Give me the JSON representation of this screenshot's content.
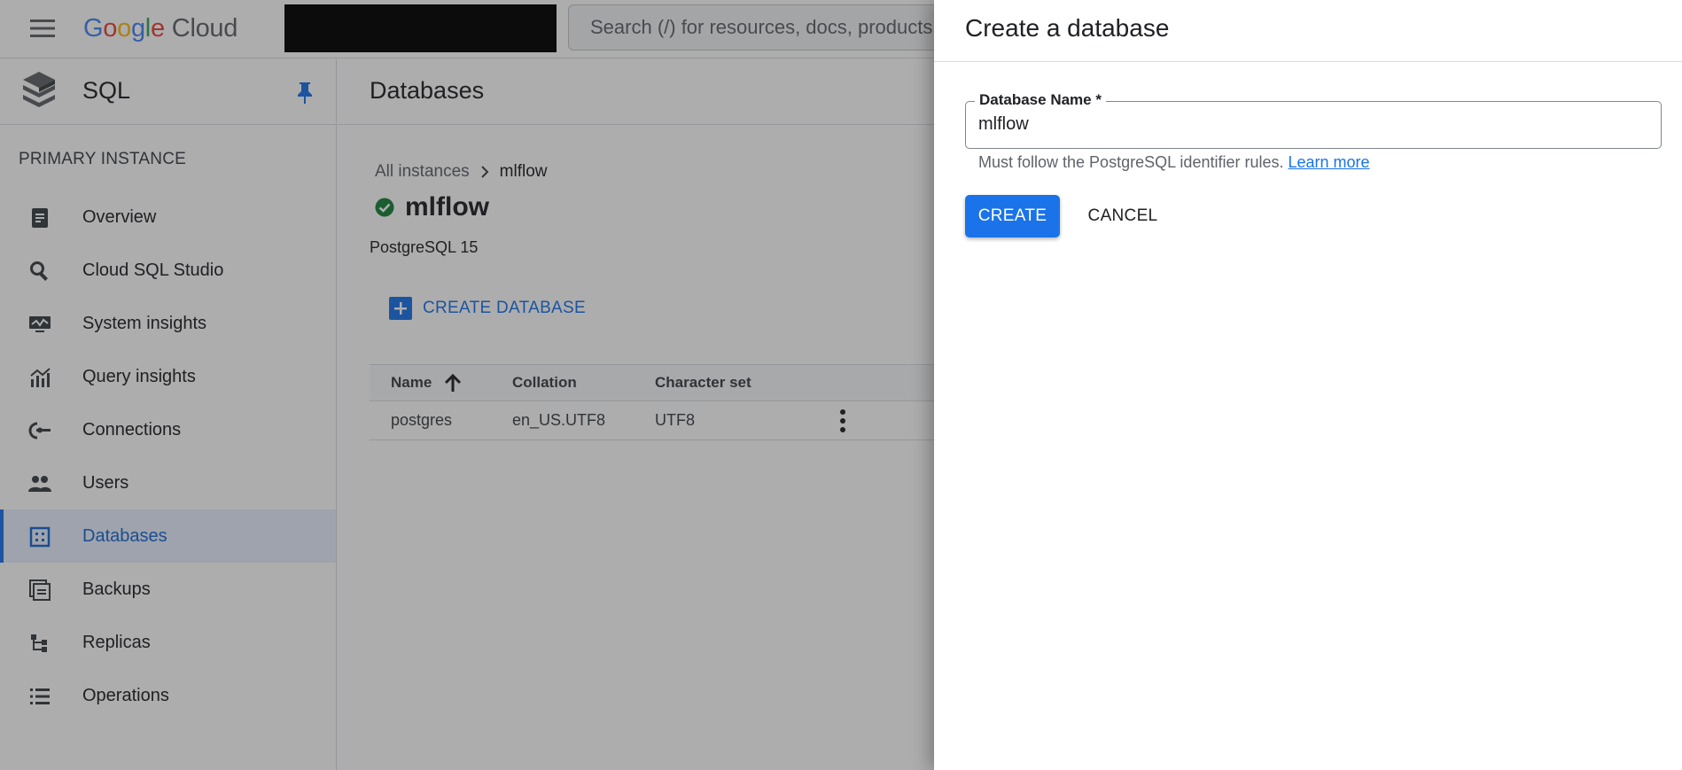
{
  "header": {
    "logo_parts": [
      "G",
      "o",
      "o",
      "g",
      "l",
      "e"
    ],
    "logo_suffix": "Cloud",
    "search_placeholder": "Search (/) for resources, docs, products"
  },
  "sidebar": {
    "product": "SQL",
    "section": "PRIMARY INSTANCE",
    "items": [
      {
        "label": "Overview",
        "icon": "overview-icon"
      },
      {
        "label": "Cloud SQL Studio",
        "icon": "search-icon"
      },
      {
        "label": "System insights",
        "icon": "monitor-icon"
      },
      {
        "label": "Query insights",
        "icon": "chart-icon"
      },
      {
        "label": "Connections",
        "icon": "connections-icon"
      },
      {
        "label": "Users",
        "icon": "users-icon"
      },
      {
        "label": "Databases",
        "icon": "databases-icon",
        "active": true
      },
      {
        "label": "Backups",
        "icon": "backups-icon"
      },
      {
        "label": "Replicas",
        "icon": "replicas-icon"
      },
      {
        "label": "Operations",
        "icon": "list-icon"
      }
    ]
  },
  "main": {
    "title": "Databases",
    "breadcrumb": {
      "parent": "All instances",
      "current": "mlflow"
    },
    "instance_name": "mlflow",
    "instance_version": "PostgreSQL 15",
    "create_label": "CREATE DATABASE",
    "table": {
      "columns": [
        "Name",
        "Collation",
        "Character set"
      ],
      "rows": [
        {
          "name": "postgres",
          "collation": "en_US.UTF8",
          "charset": "UTF8"
        }
      ]
    }
  },
  "panel": {
    "title": "Create a database",
    "field_label": "Database Name *",
    "field_value": "mlflow",
    "hint_text": "Must follow the PostgreSQL identifier rules.",
    "hint_link": "Learn more",
    "create_label": "CREATE",
    "cancel_label": "CANCEL"
  },
  "colors": {
    "accent": "#1a73e8",
    "status_ok": "#188038"
  }
}
